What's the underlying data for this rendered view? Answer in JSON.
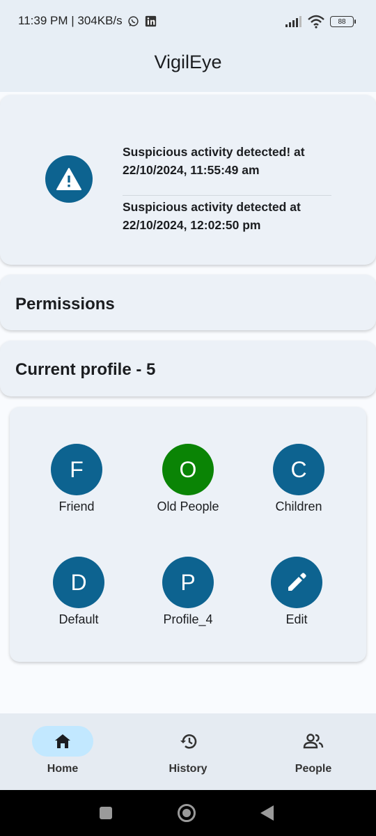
{
  "status_bar": {
    "time_speed": "11:39 PM | 304KB/s",
    "battery": "88"
  },
  "app": {
    "title": "VigilEye"
  },
  "alerts": [
    {
      "line1": "Suspicious activity detected! at",
      "line2": "22/10/2024, 11:55:49 am"
    },
    {
      "line1": "Suspicious activity detected at",
      "line2": "22/10/2024, 12:02:50 pm"
    }
  ],
  "permissions": {
    "label": "Permissions"
  },
  "current_profile": {
    "label": "Current profile - 5"
  },
  "profiles": [
    {
      "initial": "F",
      "label": "Friend",
      "color": "#0d6390"
    },
    {
      "initial": "O",
      "label": "Old People",
      "color": "#0a8405"
    },
    {
      "initial": "C",
      "label": "Children",
      "color": "#0d6390"
    },
    {
      "initial": "D",
      "label": "Default",
      "color": "#0d6390"
    },
    {
      "initial": "P",
      "label": "Profile_4",
      "color": "#0d6390"
    },
    {
      "icon": "pencil-icon",
      "label": "Edit",
      "color": "#0d6390"
    }
  ],
  "nav": [
    {
      "label": "Home",
      "icon": "home-icon",
      "active": true
    },
    {
      "label": "History",
      "icon": "history-icon",
      "active": false
    },
    {
      "label": "People",
      "icon": "people-icon",
      "active": false
    }
  ],
  "colors": {
    "accent": "#0d6390",
    "active_profile": "#0a8405",
    "nav_active": "#c2e8ff"
  }
}
